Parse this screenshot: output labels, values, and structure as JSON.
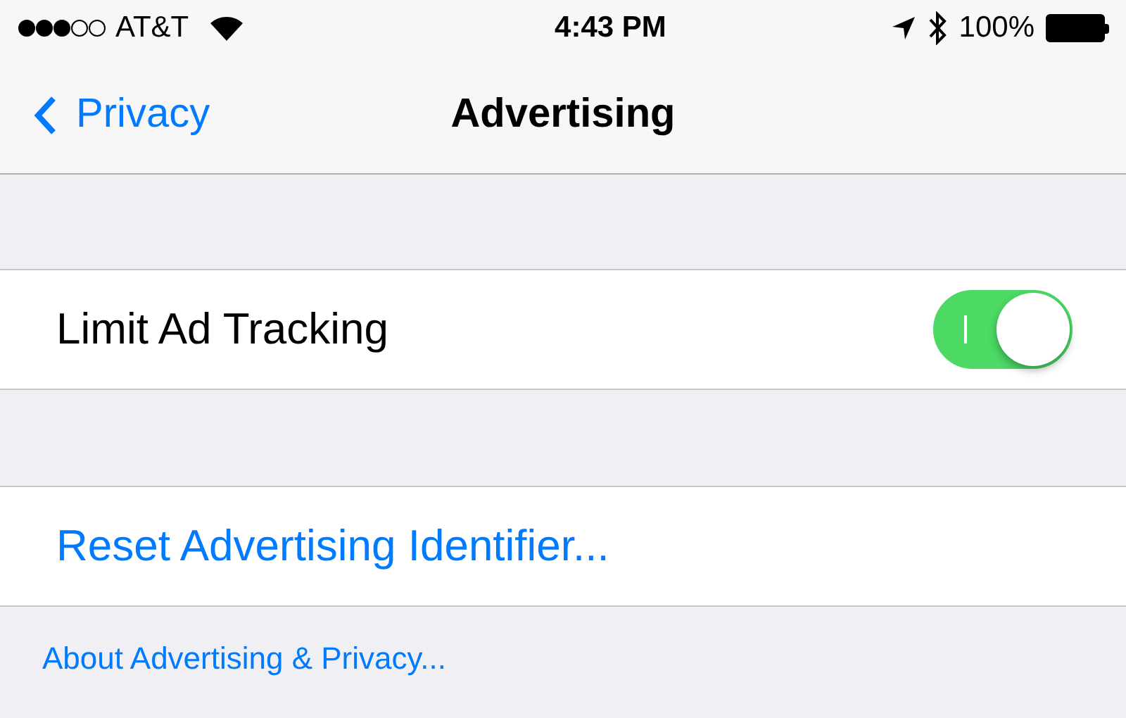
{
  "status_bar": {
    "carrier": "AT&T",
    "time": "4:43 PM",
    "battery": "100%"
  },
  "nav": {
    "back": "Privacy",
    "title": "Advertising"
  },
  "settings": [
    {
      "kind": "toggle",
      "label": "Limit Ad Tracking",
      "on": true
    },
    {
      "kind": "action",
      "label": "Reset Advertising Identifier..."
    }
  ],
  "footer_link": "About Advertising & Privacy..."
}
